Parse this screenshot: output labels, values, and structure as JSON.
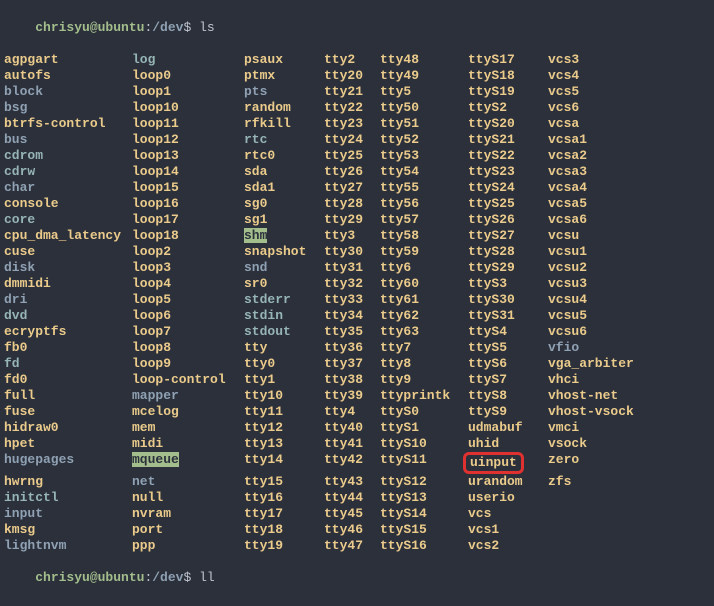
{
  "prompt": {
    "user": "chrisyu@ubuntu",
    "path": "/dev",
    "dollar": "$",
    "cmd1": "ls",
    "cmd2": "ll"
  },
  "highlight_target": "uinput",
  "columns": [
    [
      {
        "t": "agpgart",
        "c": "dev"
      },
      {
        "t": "autofs",
        "c": "dev"
      },
      {
        "t": "block",
        "c": "dir"
      },
      {
        "t": "bsg",
        "c": "dir"
      },
      {
        "t": "btrfs-control",
        "c": "dev"
      },
      {
        "t": "bus",
        "c": "dir"
      },
      {
        "t": "cdrom",
        "c": "link"
      },
      {
        "t": "cdrw",
        "c": "link"
      },
      {
        "t": "char",
        "c": "dir"
      },
      {
        "t": "console",
        "c": "dev"
      },
      {
        "t": "core",
        "c": "link"
      },
      {
        "t": "cpu_dma_latency",
        "c": "dev"
      },
      {
        "t": "cuse",
        "c": "dev"
      },
      {
        "t": "disk",
        "c": "dir"
      },
      {
        "t": "dmmidi",
        "c": "dev"
      },
      {
        "t": "dri",
        "c": "dir"
      },
      {
        "t": "dvd",
        "c": "link"
      },
      {
        "t": "ecryptfs",
        "c": "dev"
      },
      {
        "t": "fb0",
        "c": "dev"
      },
      {
        "t": "fd",
        "c": "link"
      },
      {
        "t": "fd0",
        "c": "dev"
      },
      {
        "t": "full",
        "c": "dev"
      },
      {
        "t": "fuse",
        "c": "dev"
      },
      {
        "t": "hidraw0",
        "c": "dev"
      },
      {
        "t": "hpet",
        "c": "dev"
      },
      {
        "t": "hugepages",
        "c": "dir"
      },
      {
        "t": "hwrng",
        "c": "dev"
      },
      {
        "t": "initctl",
        "c": "link"
      },
      {
        "t": "input",
        "c": "dir"
      },
      {
        "t": "kmsg",
        "c": "dev"
      },
      {
        "t": "lightnvm",
        "c": "dir"
      }
    ],
    [
      {
        "t": "log",
        "c": "link"
      },
      {
        "t": "loop0",
        "c": "dev"
      },
      {
        "t": "loop1",
        "c": "dev"
      },
      {
        "t": "loop10",
        "c": "dev"
      },
      {
        "t": "loop11",
        "c": "dev"
      },
      {
        "t": "loop12",
        "c": "dev"
      },
      {
        "t": "loop13",
        "c": "dev"
      },
      {
        "t": "loop14",
        "c": "dev"
      },
      {
        "t": "loop15",
        "c": "dev"
      },
      {
        "t": "loop16",
        "c": "dev"
      },
      {
        "t": "loop17",
        "c": "dev"
      },
      {
        "t": "loop18",
        "c": "dev"
      },
      {
        "t": "loop2",
        "c": "dev"
      },
      {
        "t": "loop3",
        "c": "dev"
      },
      {
        "t": "loop4",
        "c": "dev"
      },
      {
        "t": "loop5",
        "c": "dev"
      },
      {
        "t": "loop6",
        "c": "dev"
      },
      {
        "t": "loop7",
        "c": "dev"
      },
      {
        "t": "loop8",
        "c": "dev"
      },
      {
        "t": "loop9",
        "c": "dev"
      },
      {
        "t": "loop-control",
        "c": "dev"
      },
      {
        "t": "mapper",
        "c": "dir"
      },
      {
        "t": "mcelog",
        "c": "dev"
      },
      {
        "t": "mem",
        "c": "dev"
      },
      {
        "t": "midi",
        "c": "dev"
      },
      {
        "t": "mqueue",
        "c": "sticky"
      },
      {
        "t": "net",
        "c": "dir"
      },
      {
        "t": "null",
        "c": "dev"
      },
      {
        "t": "nvram",
        "c": "dev"
      },
      {
        "t": "port",
        "c": "dev"
      },
      {
        "t": "ppp",
        "c": "dev"
      }
    ],
    [
      {
        "t": "psaux",
        "c": "dev"
      },
      {
        "t": "ptmx",
        "c": "dev"
      },
      {
        "t": "pts",
        "c": "dir"
      },
      {
        "t": "random",
        "c": "dev"
      },
      {
        "t": "rfkill",
        "c": "dev"
      },
      {
        "t": "rtc",
        "c": "link"
      },
      {
        "t": "rtc0",
        "c": "dev"
      },
      {
        "t": "sda",
        "c": "dev"
      },
      {
        "t": "sda1",
        "c": "dev"
      },
      {
        "t": "sg0",
        "c": "dev"
      },
      {
        "t": "sg1",
        "c": "dev"
      },
      {
        "t": "shm",
        "c": "sticky"
      },
      {
        "t": "snapshot",
        "c": "dev"
      },
      {
        "t": "snd",
        "c": "dir"
      },
      {
        "t": "sr0",
        "c": "dev"
      },
      {
        "t": "stderr",
        "c": "link"
      },
      {
        "t": "stdin",
        "c": "link"
      },
      {
        "t": "stdout",
        "c": "link"
      },
      {
        "t": "tty",
        "c": "dev"
      },
      {
        "t": "tty0",
        "c": "dev"
      },
      {
        "t": "tty1",
        "c": "dev"
      },
      {
        "t": "tty10",
        "c": "dev"
      },
      {
        "t": "tty11",
        "c": "dev"
      },
      {
        "t": "tty12",
        "c": "dev"
      },
      {
        "t": "tty13",
        "c": "dev"
      },
      {
        "t": "tty14",
        "c": "dev"
      },
      {
        "t": "tty15",
        "c": "dev"
      },
      {
        "t": "tty16",
        "c": "dev"
      },
      {
        "t": "tty17",
        "c": "dev"
      },
      {
        "t": "tty18",
        "c": "dev"
      },
      {
        "t": "tty19",
        "c": "dev"
      }
    ],
    [
      {
        "t": "tty2",
        "c": "dev"
      },
      {
        "t": "tty20",
        "c": "dev"
      },
      {
        "t": "tty21",
        "c": "dev"
      },
      {
        "t": "tty22",
        "c": "dev"
      },
      {
        "t": "tty23",
        "c": "dev"
      },
      {
        "t": "tty24",
        "c": "dev"
      },
      {
        "t": "tty25",
        "c": "dev"
      },
      {
        "t": "tty26",
        "c": "dev"
      },
      {
        "t": "tty27",
        "c": "dev"
      },
      {
        "t": "tty28",
        "c": "dev"
      },
      {
        "t": "tty29",
        "c": "dev"
      },
      {
        "t": "tty3",
        "c": "dev"
      },
      {
        "t": "tty30",
        "c": "dev"
      },
      {
        "t": "tty31",
        "c": "dev"
      },
      {
        "t": "tty32",
        "c": "dev"
      },
      {
        "t": "tty33",
        "c": "dev"
      },
      {
        "t": "tty34",
        "c": "dev"
      },
      {
        "t": "tty35",
        "c": "dev"
      },
      {
        "t": "tty36",
        "c": "dev"
      },
      {
        "t": "tty37",
        "c": "dev"
      },
      {
        "t": "tty38",
        "c": "dev"
      },
      {
        "t": "tty39",
        "c": "dev"
      },
      {
        "t": "tty4",
        "c": "dev"
      },
      {
        "t": "tty40",
        "c": "dev"
      },
      {
        "t": "tty41",
        "c": "dev"
      },
      {
        "t": "tty42",
        "c": "dev"
      },
      {
        "t": "tty43",
        "c": "dev"
      },
      {
        "t": "tty44",
        "c": "dev"
      },
      {
        "t": "tty45",
        "c": "dev"
      },
      {
        "t": "tty46",
        "c": "dev"
      },
      {
        "t": "tty47",
        "c": "dev"
      }
    ],
    [
      {
        "t": "tty48",
        "c": "dev"
      },
      {
        "t": "tty49",
        "c": "dev"
      },
      {
        "t": "tty5",
        "c": "dev"
      },
      {
        "t": "tty50",
        "c": "dev"
      },
      {
        "t": "tty51",
        "c": "dev"
      },
      {
        "t": "tty52",
        "c": "dev"
      },
      {
        "t": "tty53",
        "c": "dev"
      },
      {
        "t": "tty54",
        "c": "dev"
      },
      {
        "t": "tty55",
        "c": "dev"
      },
      {
        "t": "tty56",
        "c": "dev"
      },
      {
        "t": "tty57",
        "c": "dev"
      },
      {
        "t": "tty58",
        "c": "dev"
      },
      {
        "t": "tty59",
        "c": "dev"
      },
      {
        "t": "tty6",
        "c": "dev"
      },
      {
        "t": "tty60",
        "c": "dev"
      },
      {
        "t": "tty61",
        "c": "dev"
      },
      {
        "t": "tty62",
        "c": "dev"
      },
      {
        "t": "tty63",
        "c": "dev"
      },
      {
        "t": "tty7",
        "c": "dev"
      },
      {
        "t": "tty8",
        "c": "dev"
      },
      {
        "t": "tty9",
        "c": "dev"
      },
      {
        "t": "ttyprintk",
        "c": "dev"
      },
      {
        "t": "ttyS0",
        "c": "dev"
      },
      {
        "t": "ttyS1",
        "c": "dev"
      },
      {
        "t": "ttyS10",
        "c": "dev"
      },
      {
        "t": "ttyS11",
        "c": "dev"
      },
      {
        "t": "ttyS12",
        "c": "dev"
      },
      {
        "t": "ttyS13",
        "c": "dev"
      },
      {
        "t": "ttyS14",
        "c": "dev"
      },
      {
        "t": "ttyS15",
        "c": "dev"
      },
      {
        "t": "ttyS16",
        "c": "dev"
      }
    ],
    [
      {
        "t": "ttyS17",
        "c": "dev"
      },
      {
        "t": "ttyS18",
        "c": "dev"
      },
      {
        "t": "ttyS19",
        "c": "dev"
      },
      {
        "t": "ttyS2",
        "c": "dev"
      },
      {
        "t": "ttyS20",
        "c": "dev"
      },
      {
        "t": "ttyS21",
        "c": "dev"
      },
      {
        "t": "ttyS22",
        "c": "dev"
      },
      {
        "t": "ttyS23",
        "c": "dev"
      },
      {
        "t": "ttyS24",
        "c": "dev"
      },
      {
        "t": "ttyS25",
        "c": "dev"
      },
      {
        "t": "ttyS26",
        "c": "dev"
      },
      {
        "t": "ttyS27",
        "c": "dev"
      },
      {
        "t": "ttyS28",
        "c": "dev"
      },
      {
        "t": "ttyS29",
        "c": "dev"
      },
      {
        "t": "ttyS3",
        "c": "dev"
      },
      {
        "t": "ttyS30",
        "c": "dev"
      },
      {
        "t": "ttyS31",
        "c": "dev"
      },
      {
        "t": "ttyS4",
        "c": "dev"
      },
      {
        "t": "ttyS5",
        "c": "dev"
      },
      {
        "t": "ttyS6",
        "c": "dev"
      },
      {
        "t": "ttyS7",
        "c": "dev"
      },
      {
        "t": "ttyS8",
        "c": "dev"
      },
      {
        "t": "ttyS9",
        "c": "dev"
      },
      {
        "t": "udmabuf",
        "c": "dev"
      },
      {
        "t": "uhid",
        "c": "dev"
      },
      {
        "t": "uinput",
        "c": "dev"
      },
      {
        "t": "urandom",
        "c": "dev"
      },
      {
        "t": "userio",
        "c": "dev"
      },
      {
        "t": "vcs",
        "c": "dev"
      },
      {
        "t": "vcs1",
        "c": "dev"
      },
      {
        "t": "vcs2",
        "c": "dev"
      }
    ],
    [
      {
        "t": "vcs3",
        "c": "dev"
      },
      {
        "t": "vcs4",
        "c": "dev"
      },
      {
        "t": "vcs5",
        "c": "dev"
      },
      {
        "t": "vcs6",
        "c": "dev"
      },
      {
        "t": "vcsa",
        "c": "dev"
      },
      {
        "t": "vcsa1",
        "c": "dev"
      },
      {
        "t": "vcsa2",
        "c": "dev"
      },
      {
        "t": "vcsa3",
        "c": "dev"
      },
      {
        "t": "vcsa4",
        "c": "dev"
      },
      {
        "t": "vcsa5",
        "c": "dev"
      },
      {
        "t": "vcsa6",
        "c": "dev"
      },
      {
        "t": "vcsu",
        "c": "dev"
      },
      {
        "t": "vcsu1",
        "c": "dev"
      },
      {
        "t": "vcsu2",
        "c": "dev"
      },
      {
        "t": "vcsu3",
        "c": "dev"
      },
      {
        "t": "vcsu4",
        "c": "dev"
      },
      {
        "t": "vcsu5",
        "c": "dev"
      },
      {
        "t": "vcsu6",
        "c": "dev"
      },
      {
        "t": "vfio",
        "c": "dir"
      },
      {
        "t": "vga_arbiter",
        "c": "dev"
      },
      {
        "t": "vhci",
        "c": "dev"
      },
      {
        "t": "vhost-net",
        "c": "dev"
      },
      {
        "t": "vhost-vsock",
        "c": "dev"
      },
      {
        "t": "vmci",
        "c": "dev"
      },
      {
        "t": "vsock",
        "c": "dev"
      },
      {
        "t": "zero",
        "c": "dev"
      },
      {
        "t": "zfs",
        "c": "dev"
      }
    ]
  ]
}
